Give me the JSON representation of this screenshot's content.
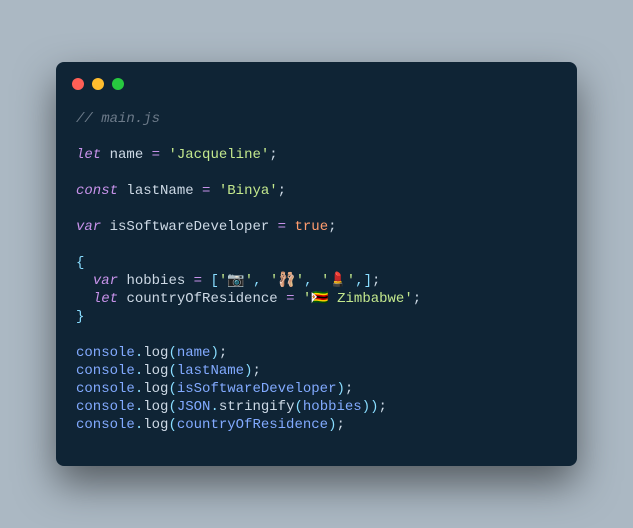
{
  "comment": "// main.js",
  "kw": {
    "let": "let",
    "const": "const",
    "var": "var",
    "true": "true"
  },
  "id": {
    "name": "name",
    "lastName": "lastName",
    "isSoftwareDeveloper": "isSoftwareDeveloper",
    "hobbies": "hobbies",
    "countryOfResidence": "countryOfResidence",
    "console": "console",
    "JSON": "JSON"
  },
  "fn": {
    "log": "log",
    "stringify": "stringify"
  },
  "str": {
    "jacqueline": "'Jacqueline'",
    "binya": "'Binya'",
    "hobby1": "'📷'",
    "hobby2": "'🩰'",
    "hobby3": "'💄'",
    "country": "'🇿🇼 Zimbabwe'"
  },
  "p": {
    "eq": " = ",
    "dot": ".",
    "lpar": "(",
    "rpar": ")",
    "lbrk": "[",
    "rbrk": "]",
    "lbrace": "{",
    "rbrace": "}",
    "comma": ", ",
    "commatrail": ",",
    "semi": ";"
  }
}
